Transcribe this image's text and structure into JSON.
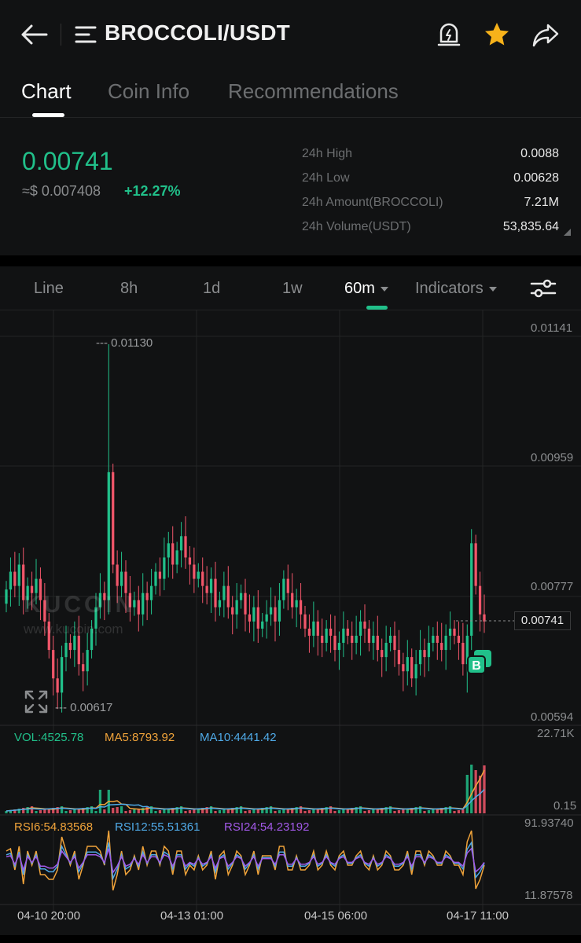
{
  "header": {
    "pair": "BROCCOLI/USDT"
  },
  "tabs": [
    {
      "label": "Chart",
      "active": true
    },
    {
      "label": "Coin Info",
      "active": false
    },
    {
      "label": "Recommendations",
      "active": false
    }
  ],
  "price": {
    "last": "0.00741",
    "usd": "≈$ 0.007408",
    "change": "+12.27%"
  },
  "stats": [
    {
      "label": "24h High",
      "value": "0.0088"
    },
    {
      "label": "24h Low",
      "value": "0.00628"
    },
    {
      "label": "24h Amount(BROCCOLI)",
      "value": "7.21M"
    },
    {
      "label": "24h Volume(USDT)",
      "value": "53,835.64"
    }
  ],
  "toolbar": {
    "items": [
      "Line",
      "8h",
      "1d",
      "1w",
      "60m",
      "Indicators"
    ],
    "active": "60m"
  },
  "watermark": {
    "name": "KUCOIN",
    "url": "www.kucoin.com"
  },
  "chart_data": {
    "type": "candlestick",
    "interval": "60m",
    "price_axis": [
      "0.01141",
      "0.00959",
      "0.00777",
      "0.00594"
    ],
    "ylim": [
      0.00594,
      0.01141
    ],
    "current_price": "0.00741",
    "period_high": "0.01130",
    "period_low": "0.00617",
    "x_ticks": [
      "04-10 20:00",
      "04-13 01:00",
      "04-15 06:00",
      "04-17 11:00"
    ],
    "closes": [
      0.00785,
      0.0081,
      0.0079,
      0.0082,
      0.0077,
      0.0079,
      0.0078,
      0.008,
      0.0077,
      0.0074,
      0.007,
      0.0066,
      0.0064,
      0.0069,
      0.0071,
      0.007,
      0.0072,
      0.0068,
      0.0067,
      0.007,
      0.0073,
      0.0076,
      0.0078,
      0.0077,
      0.0095,
      0.0082,
      0.0079,
      0.0081,
      0.0078,
      0.0076,
      0.0077,
      0.0075,
      0.0078,
      0.0077,
      0.0079,
      0.0081,
      0.008,
      0.0083,
      0.0085,
      0.0082,
      0.0084,
      0.0086,
      0.0083,
      0.0082,
      0.008,
      0.0081,
      0.0079,
      0.0078,
      0.008,
      0.0076,
      0.0077,
      0.0079,
      0.0076,
      0.0075,
      0.0077,
      0.0078,
      0.0075,
      0.0074,
      0.0076,
      0.0073,
      0.0074,
      0.0075,
      0.0076,
      0.0074,
      0.0077,
      0.008,
      0.0078,
      0.0076,
      0.0077,
      0.0075,
      0.0073,
      0.0072,
      0.0074,
      0.0072,
      0.0071,
      0.0073,
      0.0072,
      0.007,
      0.0071,
      0.0073,
      0.0072,
      0.0071,
      0.0072,
      0.0074,
      0.0073,
      0.0071,
      0.0072,
      0.007,
      0.0069,
      0.0071,
      0.0072,
      0.007,
      0.0068,
      0.0067,
      0.0069,
      0.0066,
      0.0068,
      0.007,
      0.0069,
      0.0071,
      0.0072,
      0.0071,
      0.007,
      0.0072,
      0.0073,
      0.0072,
      0.0071,
      0.0068,
      0.0072,
      0.0085,
      0.0079,
      0.0075,
      0.0074
    ]
  },
  "indicators": {
    "vol": {
      "vol": "VOL:4525.78",
      "ma5": "MA5:8793.92",
      "ma10": "MA10:4441.42",
      "axis_max": "22.71K",
      "axis_min": "0.15"
    },
    "rsi": {
      "rsi6": "RSI6:54.83568",
      "rsi12": "RSI12:55.51361",
      "rsi24": "RSI24:54.23192",
      "axis_max": "91.93740",
      "axis_min": "11.87578"
    }
  },
  "colors": {
    "up": "#21c08a",
    "down": "#f1566a",
    "ma5": "#f0a33a",
    "ma10": "#4fa9e6",
    "rsi6": "#f0a33a",
    "rsi12": "#4fa9e6",
    "rsi24": "#a259e8",
    "star": "#f7b21a"
  }
}
